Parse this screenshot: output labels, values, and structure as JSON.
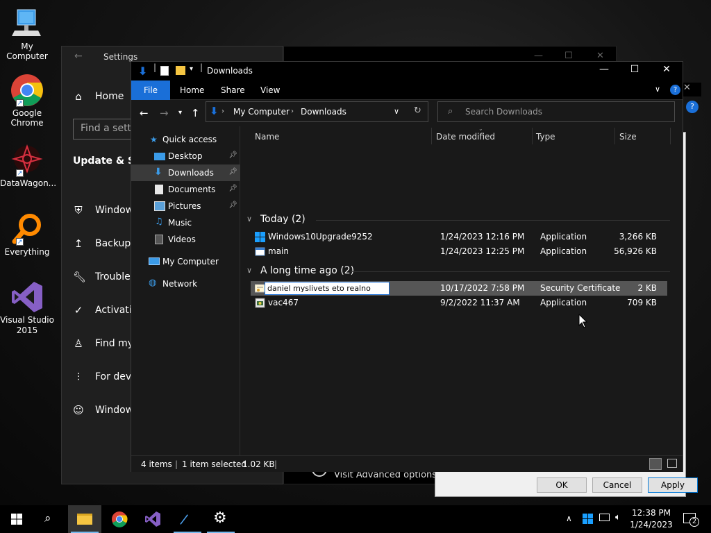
{
  "desktop": {
    "icons": [
      {
        "label": "My Computer"
      },
      {
        "label": "Google Chrome"
      },
      {
        "label": "DataWagon..."
      },
      {
        "label": "Everything"
      },
      {
        "label": "Visual Studio 2015"
      }
    ]
  },
  "settings": {
    "title": "Settings",
    "home": "Home",
    "search_placeholder": "Find a settin",
    "section": "Update & Sec",
    "items": [
      "Windows",
      "Backup",
      "Troubles",
      "Activatio",
      "Find my",
      "For deve",
      "Windows"
    ]
  },
  "background_window": {
    "message": "Visit Advanced options to change the pause period"
  },
  "dialog": {
    "ok": "OK",
    "cancel": "Cancel",
    "apply": "Apply"
  },
  "explorer": {
    "title": "Downloads",
    "ribbon_tabs": [
      "File",
      "Home",
      "Share",
      "View"
    ],
    "breadcrumb": [
      "My Computer",
      "Downloads"
    ],
    "search_placeholder": "Search Downloads",
    "nav": [
      {
        "label": "Quick access"
      },
      {
        "label": "Desktop"
      },
      {
        "label": "Downloads"
      },
      {
        "label": "Documents"
      },
      {
        "label": "Pictures"
      },
      {
        "label": "Music"
      },
      {
        "label": "Videos"
      },
      {
        "label": "My Computer"
      },
      {
        "label": "Network"
      }
    ],
    "columns": [
      "Name",
      "Date modified",
      "Type",
      "Size"
    ],
    "groups": [
      {
        "label": "Today (2)",
        "files": [
          {
            "name": "Windows10Upgrade9252",
            "date": "1/24/2023 12:16 PM",
            "type": "Application",
            "size": "3,266 KB"
          },
          {
            "name": "main",
            "date": "1/24/2023 12:25 PM",
            "type": "Application",
            "size": "56,926 KB"
          }
        ]
      },
      {
        "label": "A long time ago (2)",
        "files": [
          {
            "name": "daniel myslivets eto realno",
            "date": "10/17/2022 7:58 PM",
            "type": "Security Certificate",
            "size": "2 KB"
          },
          {
            "name": "vac467",
            "date": "9/2/2022 11:37 AM",
            "type": "Application",
            "size": "709 KB"
          }
        ]
      }
    ],
    "status": {
      "items": "4 items",
      "selected": "1 item selected",
      "size": "1.02 KB"
    }
  },
  "taskbar": {
    "time": "12:38 PM",
    "date": "1/24/2023",
    "notification_count": "2"
  },
  "colors": {
    "accent": "#1a6fd8",
    "window_bg": "#191919",
    "selection": "#565656"
  }
}
